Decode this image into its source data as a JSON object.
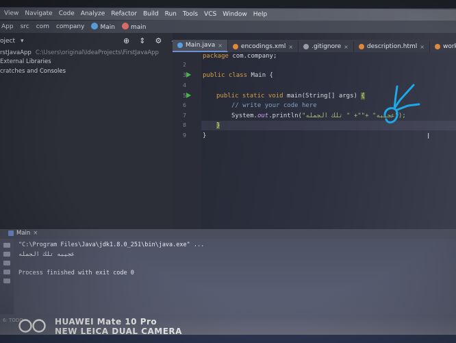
{
  "menu": [
    "View",
    "Navigate",
    "Code",
    "Analyze",
    "Refactor",
    "Build",
    "Run",
    "Tools",
    "VCS",
    "Window",
    "Help"
  ],
  "breadcrumb": [
    "App",
    "src",
    "com",
    "company",
    "Main",
    "main"
  ],
  "project_panel": {
    "header": "oject",
    "rows": [
      {
        "label": "rstJavaApp",
        "path": "C:\\Users\\original\\IdeaProjects\\FirstJavaApp"
      },
      {
        "label": "External Libraries",
        "path": ""
      },
      {
        "label": "cratches and Consoles",
        "path": ""
      }
    ]
  },
  "tabs": [
    {
      "label": "Main.java",
      "active": true,
      "color": "#5aa0e0"
    },
    {
      "label": "encodings.xml",
      "active": false,
      "color": "#e08a3a"
    },
    {
      "label": ".gitignore",
      "active": false,
      "color": "#9a9aa8"
    },
    {
      "label": "description.html",
      "active": false,
      "color": "#e08a3a"
    },
    {
      "label": "workspace.xml",
      "active": false,
      "color": "#e08a3a"
    }
  ],
  "code": {
    "line_numbers": [
      "2",
      "3",
      "4",
      "5",
      "6",
      "7",
      "8",
      "9"
    ],
    "package_kw": "package",
    "package_name": " com.company;",
    "class_kw": "public class",
    "class_name": " Main {",
    "method_kw": "public static void",
    "method_sig": " main(String[] args) ",
    "open_brace": "{",
    "comment": "// write your code here",
    "println_prefix": "System.",
    "println_out": "out",
    "println_call": ".println(",
    "println_args": "\"عجيبه\" +\"\"+ \" تلك الجمله\");",
    "close_method": "}",
    "close_class": "}"
  },
  "run": {
    "tab_label": "Main",
    "console_lines": [
      "\"C:\\Program Files\\Java\\jdk1.8.0_251\\bin\\java.exe\" ...",
      "عجيبه تلك الجمله",
      "",
      "Process finished with exit code 0"
    ]
  },
  "status_faded": "6: TODO",
  "watermark": {
    "line1": "HUAWEI Mate 10 Pro",
    "line2": "NEW LEICA DUAL CAMERA"
  },
  "colors": {
    "annotation": "#1ea8e8",
    "run_arrow": "#4bb34b"
  }
}
